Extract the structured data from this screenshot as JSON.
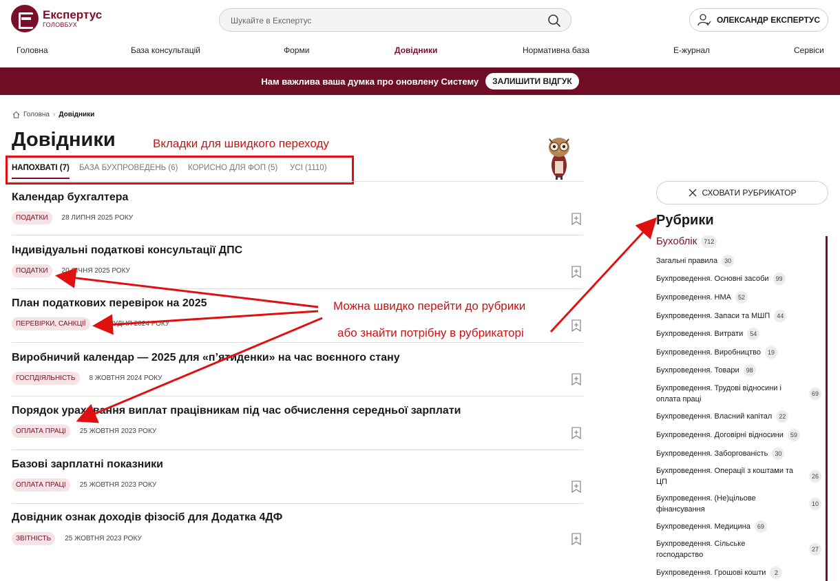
{
  "header": {
    "logo_title": "Експертус",
    "logo_subtitle": "ГОЛОВБУХ",
    "search_placeholder": "Шукайте в Експертус",
    "user_label": "ОЛЕКСАНДР ЕКСПЕРТУС"
  },
  "nav": [
    {
      "label": "Головна",
      "active": false
    },
    {
      "label": "База консультацій",
      "active": false
    },
    {
      "label": "Форми",
      "active": false
    },
    {
      "label": "Довідники",
      "active": true
    },
    {
      "label": "Нормативна база",
      "active": false
    },
    {
      "label": "Е-журнал",
      "active": false
    },
    {
      "label": "Сервіси",
      "active": false
    }
  ],
  "banner": {
    "text": "Нам важлива ваша думка про оновлену Систему",
    "button": "ЗАЛИШИТИ ВІДГУК"
  },
  "breadcrumb": {
    "home": "Головна",
    "current": "Довідники"
  },
  "page_title": "Довідники",
  "annotations": {
    "tabs_note": "Вкладки для швидкого переходу",
    "rubric_note_line1": "Можна швидко перейти до рубрики",
    "rubric_note_line2": "або знайти потрібну в рубрикаторі"
  },
  "tabs": [
    {
      "label": "НАПОХВАТІ (7)",
      "active": true
    },
    {
      "label": "БАЗА БУХПРОВЕДЕНЬ (6)",
      "active": false
    },
    {
      "label": "КОРИСНО ДЛЯ ФОП (5)",
      "active": false
    },
    {
      "label": "УСІ (1110)",
      "active": false
    }
  ],
  "articles": [
    {
      "title": "Календар бухгалтера",
      "tag": "ПОДАТКИ",
      "date": "28 ЛИПНЯ 2025 РОКУ"
    },
    {
      "title": "Індивідуальні податкові консультації ДПС",
      "tag": "ПОДАТКИ",
      "date": "20 СІЧНЯ 2025 РОКУ"
    },
    {
      "title": "План податкових перевірок на 2025",
      "tag": "ПЕРЕВІРКИ, САНКЦІЇ",
      "date": "4 ГРУДНЯ 2024 РОКУ"
    },
    {
      "title": "Виробничий календар — 2025 для «п’ятиденки» на час воєнного стану",
      "tag": "ГОСПДІЯЛЬНІСТЬ",
      "date": "8 ЖОВТНЯ 2024 РОКУ"
    },
    {
      "title": "Порядок урахування виплат працівникам під час обчислення середньої зарплати",
      "tag": "ОПЛАТА ПРАЦІ",
      "date": "25 ЖОВТНЯ 2023 РОКУ"
    },
    {
      "title": "Базові зарплатні показники",
      "tag": "ОПЛАТА ПРАЦІ",
      "date": "25 ЖОВТНЯ 2023 РОКУ"
    },
    {
      "title": "Довідник ознак доходів фізосіб для Додатка 4ДФ",
      "tag": "ЗВІТНІСТЬ",
      "date": "25 ЖОВТНЯ 2023 РОКУ"
    }
  ],
  "sidebar": {
    "hide_button": "СХОВАТИ РУБРИКАТОР",
    "title": "Рубрики",
    "rubrics": [
      {
        "label": "Бухоблік",
        "count": "712"
      },
      {
        "label": "Загальні правила",
        "count": "30"
      },
      {
        "label": "Бухпроведення. Основні засоби",
        "count": "99"
      },
      {
        "label": "Бухпроведення. НМА",
        "count": "52"
      },
      {
        "label": "Бухпроведення. Запаси та МШП",
        "count": "44"
      },
      {
        "label": "Бухпроведення. Витрати",
        "count": "54"
      },
      {
        "label": "Бухпроведення. Виробництво",
        "count": "19"
      },
      {
        "label": "Бухпроведення. Товари",
        "count": "98"
      },
      {
        "label": "Бухпроведення. Трудові відносини і оплата праці",
        "count": "69"
      },
      {
        "label": "Бухпроведення. Власний капітал",
        "count": "22"
      },
      {
        "label": "Бухпроведення. Договірні відносини",
        "count": "59"
      },
      {
        "label": "Бухпроведення. Заборгованість",
        "count": "30"
      },
      {
        "label": "Бухпроведення. Операції з коштами та ЦП",
        "count": "26"
      },
      {
        "label": "Бухпроведення. (Не)цільове фінансування",
        "count": "10"
      },
      {
        "label": "Бухпроведення. Медицина",
        "count": "69"
      },
      {
        "label": "Бухпроведення. Сільське господарство",
        "count": "27"
      },
      {
        "label": "Бухпроведення. Грошові кошти",
        "count": "2"
      }
    ]
  },
  "icons": {
    "search": "search-icon",
    "user": "user-icon",
    "home": "home-icon",
    "bookmark": "bookmark-icon",
    "close": "close-icon"
  },
  "colors": {
    "brand": "#7a1028",
    "banner": "#6e0d25",
    "annotation": "#e01010"
  }
}
